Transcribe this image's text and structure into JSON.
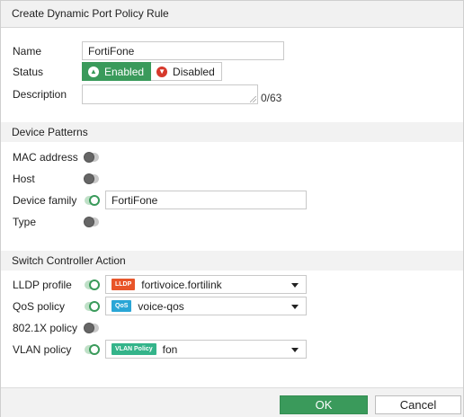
{
  "dialog": {
    "title": "Create Dynamic Port Policy Rule"
  },
  "general": {
    "name_label": "Name",
    "name_value": "FortiFone",
    "status_label": "Status",
    "status_enabled": "Enabled",
    "status_disabled": "Disabled",
    "status_selected": "Enabled",
    "description_label": "Description",
    "description_value": "",
    "description_counter": "0/63"
  },
  "device_patterns": {
    "header": "Device Patterns",
    "mac_label": "MAC address",
    "mac_enabled": false,
    "host_label": "Host",
    "host_enabled": false,
    "family_label": "Device family",
    "family_enabled": true,
    "family_value": "FortiFone",
    "type_label": "Type",
    "type_enabled": false
  },
  "switch_controller": {
    "header": "Switch Controller Action",
    "lldp_label": "LLDP profile",
    "lldp_enabled": true,
    "lldp_tag": "LLDP",
    "lldp_value": "fortivoice.fortilink",
    "qos_label": "QoS policy",
    "qos_enabled": true,
    "qos_tag": "QoS",
    "qos_value": "voice-qos",
    "dot1x_label": "802.1X policy",
    "dot1x_enabled": false,
    "vlan_label": "VLAN policy",
    "vlan_enabled": true,
    "vlan_tag": "VLAN Policy",
    "vlan_value": "fon"
  },
  "footer": {
    "ok_label": "OK",
    "cancel_label": "Cancel"
  },
  "colors": {
    "accent_green": "#3a9a5b",
    "disabled_red": "#d6382b",
    "lldp_tag": "#e8552a",
    "qos_tag": "#2aa6d6",
    "vlan_tag": "#34b48a"
  }
}
